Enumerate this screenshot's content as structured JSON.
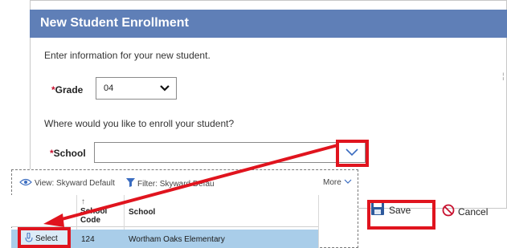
{
  "dialog": {
    "title": "New Student Enrollment",
    "intro": "Enter information for your new student.",
    "grade_required_mark": "*",
    "grade_label": "Grade",
    "grade_value": "04",
    "question": "Where would you like to enroll your student?",
    "school_required_mark": "*",
    "school_label": "School",
    "school_value": ""
  },
  "browse": {
    "view_label": "View: Skyward Default",
    "filter_label": "Filter: Skyward Default",
    "more_label": "More",
    "columns": [
      {
        "label": "School Code"
      },
      {
        "label": "School"
      }
    ],
    "rows": [
      {
        "action": "Select",
        "code": "124",
        "school": "Wortham Oaks Elementary"
      }
    ]
  },
  "actions": {
    "save_label": "Save",
    "cancel_label": "Cancel"
  },
  "colors": {
    "header": "#5f7fb7",
    "highlight": "#e0141e",
    "selected_row": "#a9cde9",
    "required": "#c8102e"
  },
  "icons": [
    "chevron-down-icon",
    "eye-icon",
    "filter-icon",
    "sort-arrow-icon",
    "select-hand-icon",
    "save-disk-icon",
    "cancel-icon"
  ]
}
